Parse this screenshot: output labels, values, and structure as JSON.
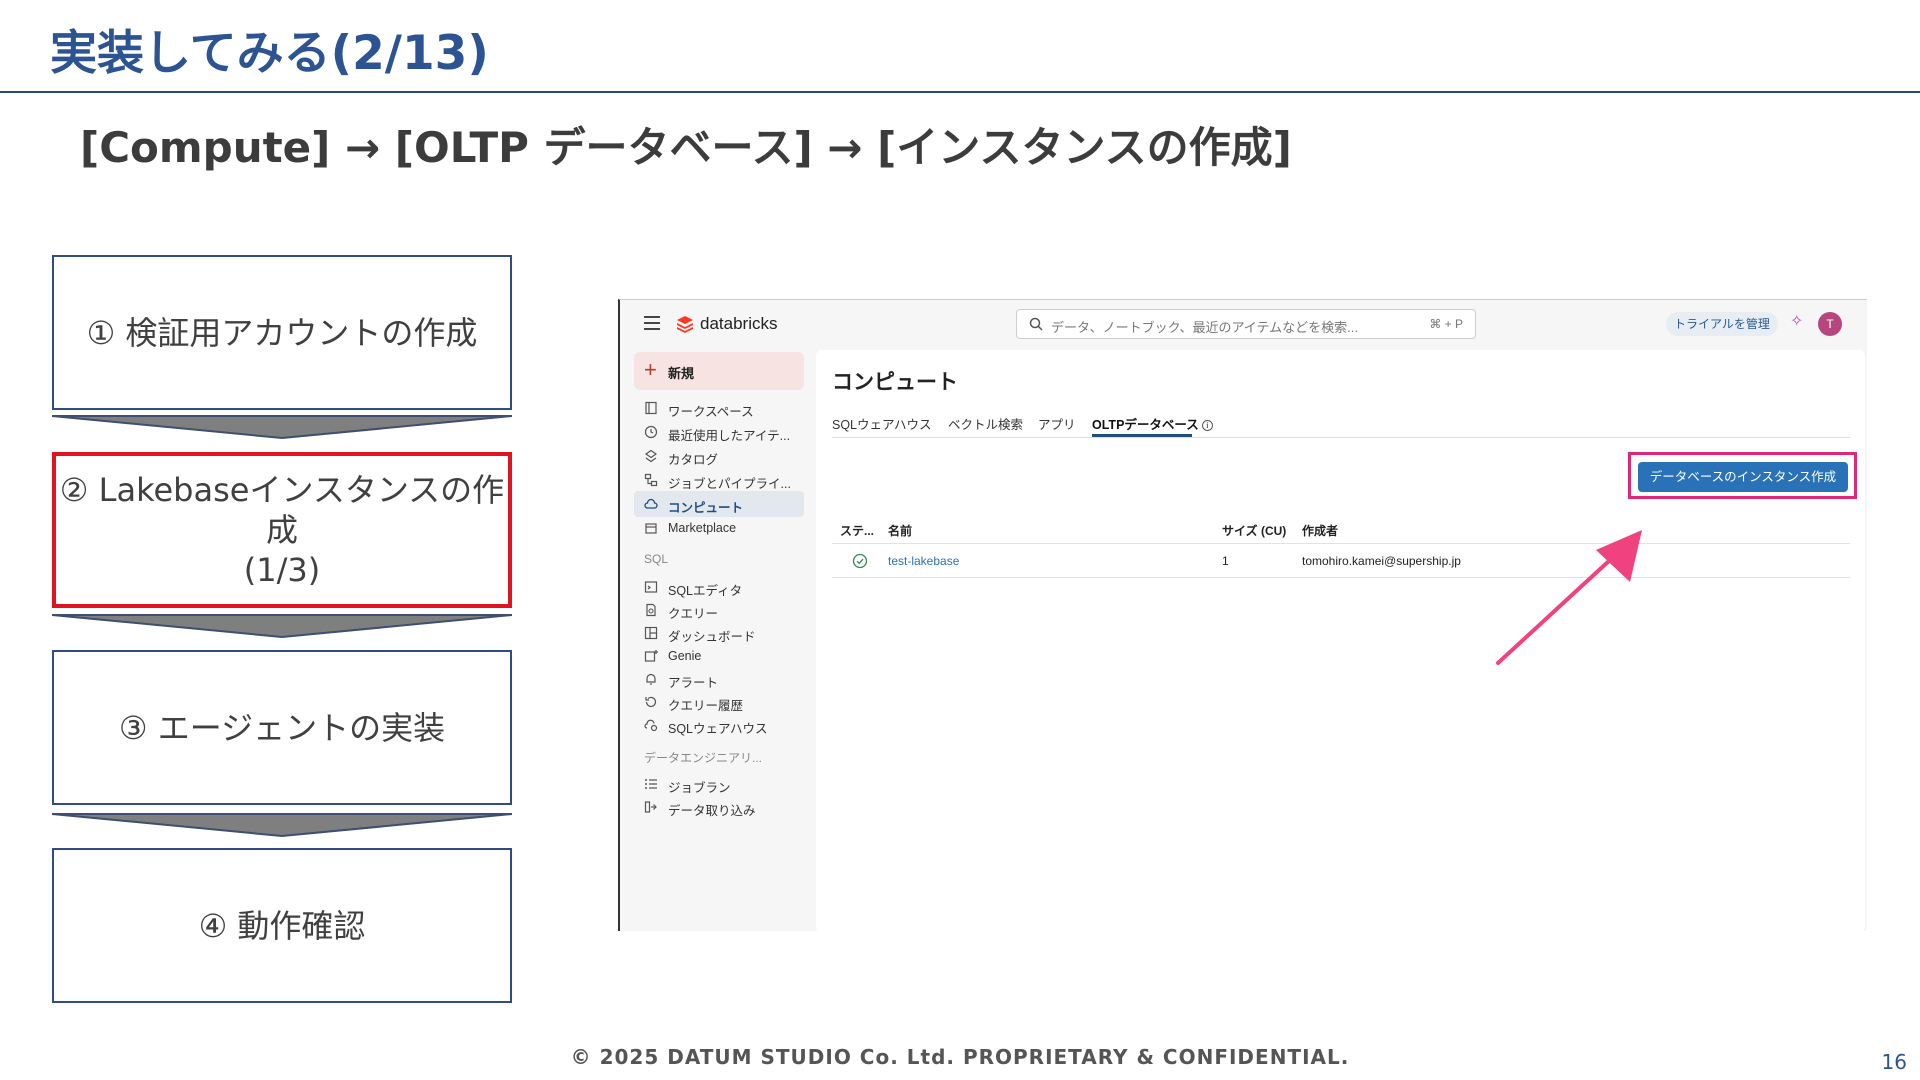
{
  "slide": {
    "title": "実装してみる(2/13)",
    "subtitle": "[Compute] → [OLTP データベース] → [インスタンスの作成]",
    "footer": "© 2025 DATUM STUDIO Co. Ltd. PROPRIETARY & CONFIDENTIAL.",
    "page_number": "16"
  },
  "steps": [
    {
      "line1": "① 検証用アカウントの作成",
      "line2": ""
    },
    {
      "line1": "② Lakebaseインスタンスの作成",
      "line2": "(1/3)"
    },
    {
      "line1": "③ エージェントの実装",
      "line2": ""
    },
    {
      "line1": "④ 動作確認",
      "line2": ""
    }
  ],
  "colors": {
    "title_blue": "#2d5492",
    "active_step_border": "#e0141e",
    "highlight_pink": "#e0287a",
    "databricks_button": "#2a72b8"
  },
  "databricks": {
    "logo_text": "databricks",
    "search_placeholder": "データ、ノートブック、最近のアイテムなどを検索...",
    "search_shortcut": "⌘ + P",
    "trial_label": "トライアルを管理",
    "avatar_initial": "T",
    "new_label": "新規",
    "nav_items": [
      {
        "label": "ワークスペース",
        "icon": "workspace-icon"
      },
      {
        "label": "最近使用したアイテ...",
        "icon": "clock-icon"
      },
      {
        "label": "カタログ",
        "icon": "catalog-icon"
      },
      {
        "label": "ジョブとパイプライ...",
        "icon": "workflow-icon"
      },
      {
        "label": "コンピュート",
        "icon": "cloud-icon"
      },
      {
        "label": "Marketplace",
        "icon": "marketplace-icon"
      }
    ],
    "sql_section": "SQL",
    "sql_items": [
      {
        "label": "SQLエディタ",
        "icon": "sql-editor-icon"
      },
      {
        "label": "クエリー",
        "icon": "query-icon"
      },
      {
        "label": "ダッシュボード",
        "icon": "dashboard-icon"
      },
      {
        "label": "Genie",
        "icon": "genie-icon"
      },
      {
        "label": "アラート",
        "icon": "bell-icon"
      },
      {
        "label": "クエリー履歴",
        "icon": "history-icon"
      },
      {
        "label": "SQLウェアハウス",
        "icon": "warehouse-icon"
      }
    ],
    "de_section": "データエンジニアリ...",
    "de_items": [
      {
        "label": "ジョブラン",
        "icon": "job-runs-icon"
      },
      {
        "label": "データ取り込み",
        "icon": "ingest-icon"
      }
    ],
    "page_heading": "コンピュート",
    "tabs": [
      "SQLウェアハウス",
      "ベクトル検索",
      "アプリ",
      "OLTPデータベース"
    ],
    "active_tab": "OLTPデータベース",
    "create_button": "データベースのインスタンス作成",
    "table": {
      "headers": [
        "ステ...",
        "名前",
        "サイズ (CU)",
        "作成者"
      ],
      "rows": [
        {
          "status": "ok",
          "name": "test-lakebase",
          "size": "1",
          "creator": "tomohiro.kamei@supership.jp"
        }
      ]
    }
  }
}
